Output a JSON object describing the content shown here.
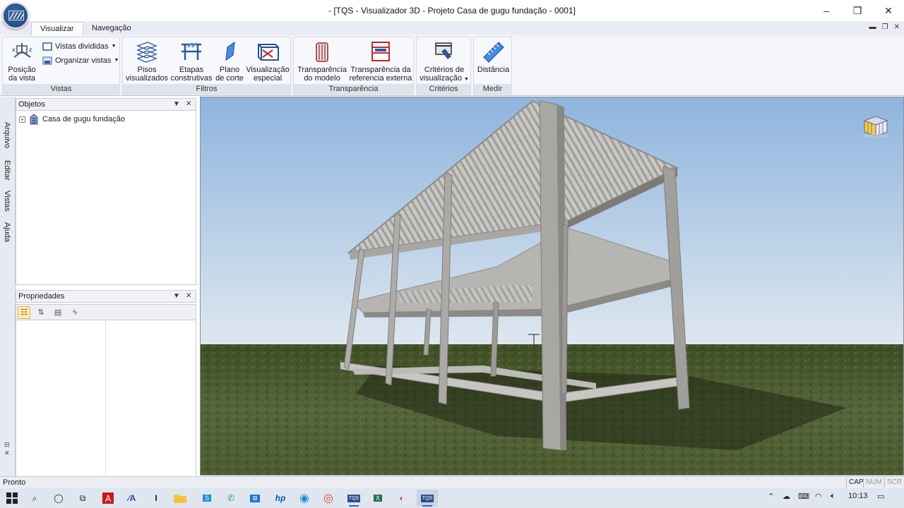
{
  "window": {
    "title": "- [TQS - Visualizador 3D - Projeto Casa de gugu fundação - 0001]",
    "controls": {
      "minimize": "–",
      "restore": "❐",
      "close": "✕"
    }
  },
  "ribbon": {
    "tabs": [
      {
        "label": "Visualizar",
        "active": true
      },
      {
        "label": "Navegação",
        "active": false
      }
    ],
    "groups": {
      "vistas": {
        "label": "Vistas",
        "posicao_line1": "Posição",
        "posicao_line2": "da vista",
        "vistas_divididas": "Vistas divididas",
        "organizar_vistas": "Organizar vistas"
      },
      "filtros": {
        "label": "Filtros",
        "pisos_line1": "Pisos",
        "pisos_line2": "visualizados",
        "etapas_line1": "Etapas",
        "etapas_line2": "construtivas",
        "plano_line1": "Plano",
        "plano_line2": "de corte",
        "visual_line1": "Visualização",
        "visual_line2": "especial"
      },
      "transparencia": {
        "label": "Transparência",
        "modelo_line1": "Transparência",
        "modelo_line2": "do modelo",
        "externa_line1": "Transparência da",
        "externa_line2": "referencia externa"
      },
      "criterios": {
        "label": "Critérios",
        "line1": "Critérios de",
        "line2": "visualização"
      },
      "medir": {
        "label": "Medir",
        "distancia": "Distância"
      }
    }
  },
  "side_tabs": [
    "Arquivo",
    "Editar",
    "Vistas",
    "Ajuda"
  ],
  "objetos_panel": {
    "title": "Objetos",
    "tree": [
      {
        "label": "Casa de gugu fundação",
        "expander": "+"
      }
    ]
  },
  "propriedades_panel": {
    "title": "Propriedades"
  },
  "statusbar": {
    "text": "Pronto",
    "indicators": [
      "CAP",
      "NUM",
      "SCR"
    ]
  },
  "taskbar": {
    "time": "10:13",
    "apps": [
      "start",
      "search",
      "cortana",
      "task-view",
      "autocad",
      "app-a",
      "app-i",
      "file-explorer",
      "app-s",
      "whatsapp",
      "store",
      "hp",
      "edge",
      "chrome",
      "tqs-1",
      "excel",
      "app-r",
      "tqs-active"
    ]
  },
  "colors": {
    "sky_top": "#8fb4de",
    "sky_bottom": "#dfe8f0",
    "ground": "#4b5a2c",
    "concrete": "#b9b7b4"
  }
}
